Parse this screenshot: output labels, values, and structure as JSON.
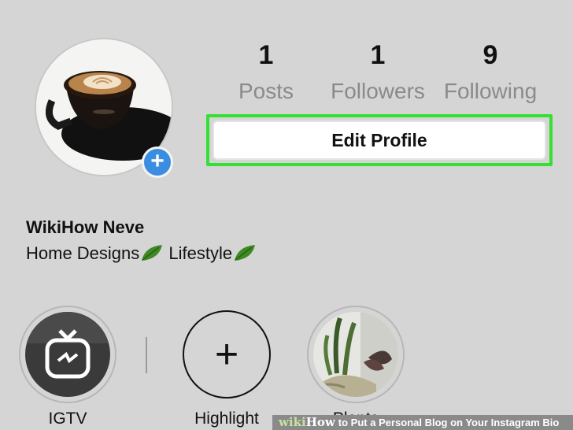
{
  "profile": {
    "name": "WikiHow Neve",
    "bio": "Home Designs",
    "bio2": "Lifestyle",
    "add_symbol": "+"
  },
  "stats": [
    {
      "value": "1",
      "label": "Posts"
    },
    {
      "value": "1",
      "label": "Followers"
    },
    {
      "value": "9",
      "label": "Following"
    }
  ],
  "edit_profile": {
    "label": "Edit Profile"
  },
  "highlights": [
    {
      "label": "IGTV"
    },
    {
      "label": "Highlight",
      "symbol": "+"
    },
    {
      "label": "Plants"
    }
  ],
  "watermark": {
    "brand_a": "wiki",
    "brand_b": "How",
    "text": "to Put a Personal Blog on Your Instagram Bio"
  },
  "colors": {
    "accent_add": "#3a8de0",
    "highlight_border": "#33e033",
    "background": "#d5d5d5"
  },
  "icons": [
    "add-photo-icon",
    "leaf-icon",
    "igtv-icon",
    "plus-icon"
  ]
}
